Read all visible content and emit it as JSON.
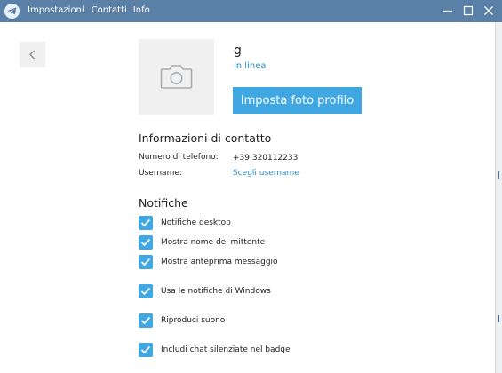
{
  "menu": {
    "settings": "Impostazioni",
    "contacts": "Contatti",
    "info": "Info"
  },
  "icons": {
    "app_logo": "telegram-plane-icon",
    "back": "chevron-left-icon",
    "avatar_placeholder": "camera-icon",
    "minimize": "minimize-icon",
    "maximize": "maximize-icon",
    "close": "close-icon",
    "checkbox": "checkmark-icon"
  },
  "colors": {
    "titlebar": "#5b80a8",
    "accent": "#40a7e3",
    "link": "#2a8ac7"
  },
  "profile": {
    "name": "g",
    "status": "in linea",
    "set_photo_button": "Imposta foto profilo"
  },
  "contact_info": {
    "title": "Informazioni di contatto",
    "phone_label": "Numero di telefono:",
    "phone_value": "+39 320112233",
    "username_label": "Username:",
    "username_value": "Scegli username"
  },
  "notifications": {
    "title": "Notifiche",
    "items": [
      {
        "label": "Notifiche desktop",
        "checked": true
      },
      {
        "label": "Mostra nome del mittente",
        "checked": true
      },
      {
        "label": "Mostra anteprima messaggio",
        "checked": true
      },
      {
        "label": "Usa le notifiche di Windows",
        "checked": true
      },
      {
        "label": "Riproduci suono",
        "checked": true
      },
      {
        "label": "Includi chat silenziate nel badge",
        "checked": true
      }
    ]
  }
}
